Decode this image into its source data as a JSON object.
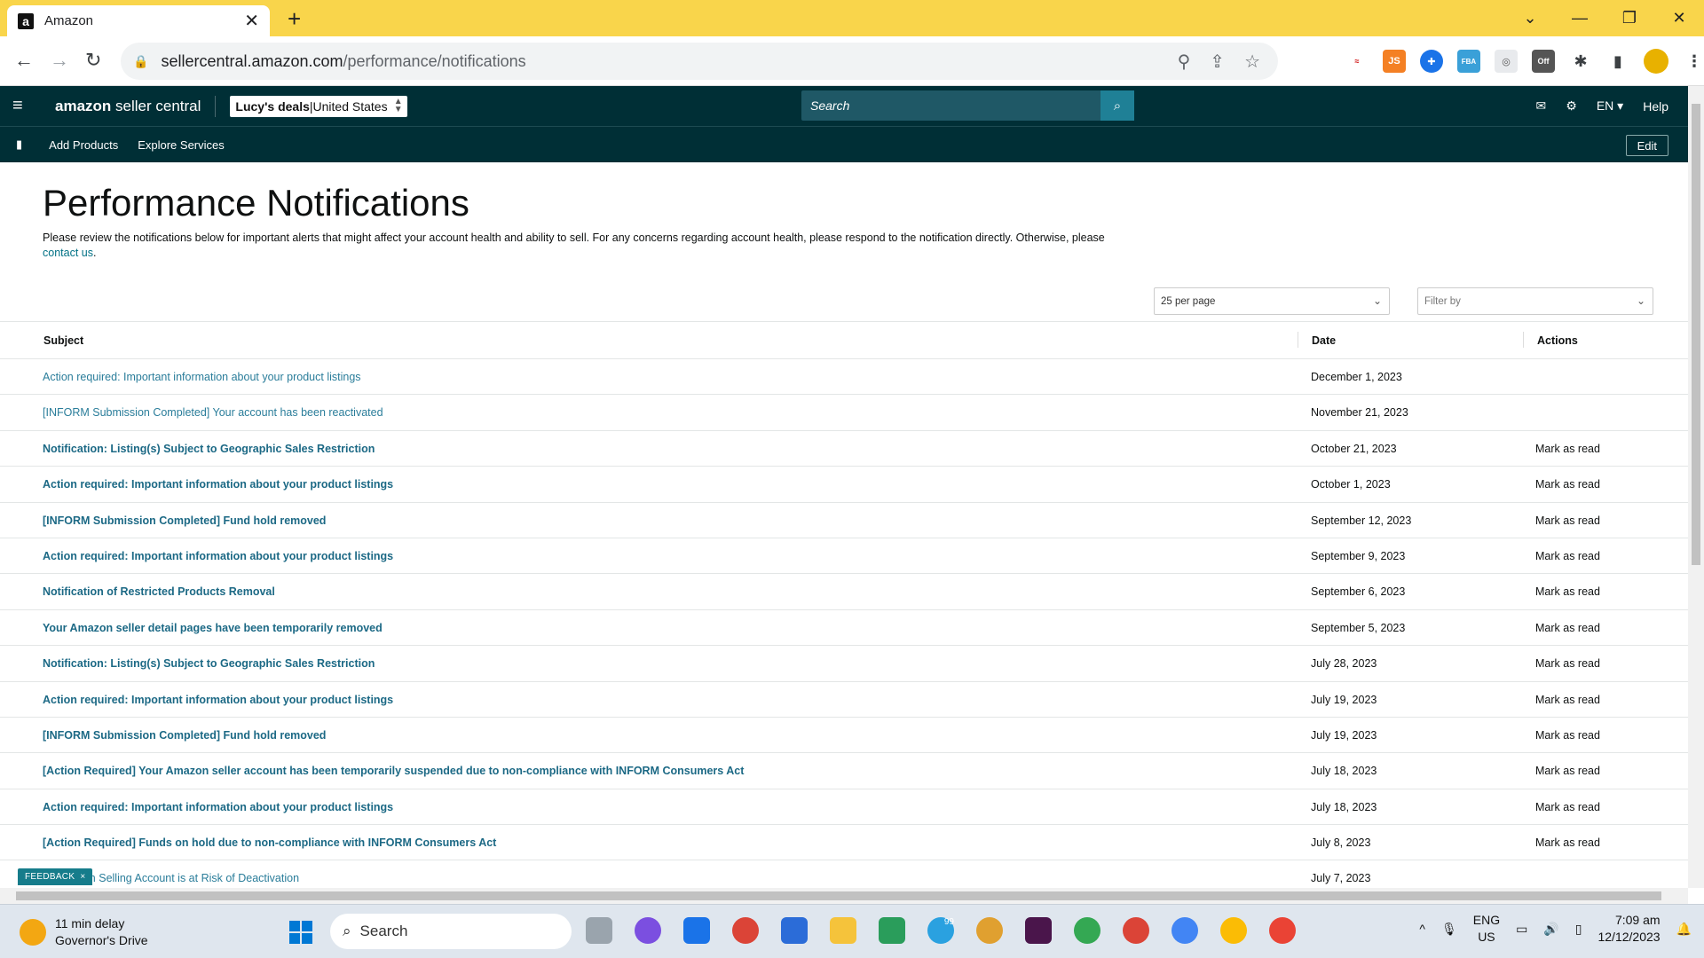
{
  "browser": {
    "tab_title": "Amazon",
    "tab_favicon": "a",
    "new_tab": "+",
    "url_host": "sellercentral.amazon.com",
    "url_path": "/performance/notifications"
  },
  "header": {
    "logo_bold": "amazon",
    "logo_rest": " seller central",
    "store_name": "Lucy's deals",
    "store_sep": " | ",
    "store_region": "United States",
    "search_placeholder": "Search",
    "lang": "EN",
    "help": "Help"
  },
  "subnav": {
    "links": [
      "Add Products",
      "Explore Services"
    ],
    "edit": "Edit"
  },
  "page": {
    "title": "Performance Notifications",
    "description": "Please review the notifications below for important alerts that might affect your account health and ability to sell. For any concerns regarding account health, please respond to the notification directly. Otherwise, please ",
    "contact_link": "contact us",
    "contact_end": ".",
    "per_page": "25 per page",
    "filter_placeholder": "Filter by"
  },
  "table": {
    "headers": {
      "subject": "Subject",
      "date": "Date",
      "actions": "Actions"
    },
    "rows": [
      {
        "subject": "Action required: Important information about your product listings",
        "date": "December 1, 2023",
        "action": "",
        "unread": false
      },
      {
        "subject": "[INFORM Submission Completed] Your account has been reactivated",
        "date": "November 21, 2023",
        "action": "",
        "unread": false
      },
      {
        "subject": "Notification: Listing(s) Subject to Geographic Sales Restriction",
        "date": "October 21, 2023",
        "action": "Mark as read",
        "unread": true
      },
      {
        "subject": "Action required: Important information about your product listings",
        "date": "October 1, 2023",
        "action": "Mark as read",
        "unread": true
      },
      {
        "subject": "[INFORM Submission Completed] Fund hold removed",
        "date": "September 12, 2023",
        "action": "Mark as read",
        "unread": true
      },
      {
        "subject": "Action required: Important information about your product listings",
        "date": "September 9, 2023",
        "action": "Mark as read",
        "unread": true
      },
      {
        "subject": "Notification of Restricted Products Removal",
        "date": "September 6, 2023",
        "action": "Mark as read",
        "unread": true
      },
      {
        "subject": "Your Amazon seller detail pages have been temporarily removed",
        "date": "September 5, 2023",
        "action": "Mark as read",
        "unread": true
      },
      {
        "subject": "Notification: Listing(s) Subject to Geographic Sales Restriction",
        "date": "July 28, 2023",
        "action": "Mark as read",
        "unread": true
      },
      {
        "subject": "Action required: Important information about your product listings",
        "date": "July 19, 2023",
        "action": "Mark as read",
        "unread": true
      },
      {
        "subject": "[INFORM Submission Completed] Fund hold removed",
        "date": "July 19, 2023",
        "action": "Mark as read",
        "unread": true
      },
      {
        "subject": "[Action Required] Your Amazon seller account has been temporarily suspended due to non-compliance with INFORM Consumers Act",
        "date": "July 18, 2023",
        "action": "Mark as read",
        "unread": true
      },
      {
        "subject": "Action required: Important information about your product listings",
        "date": "July 18, 2023",
        "action": "Mark as read",
        "unread": true
      },
      {
        "subject": "[Action Required] Funds on hold due to non-compliance with INFORM Consumers Act",
        "date": "July 8, 2023",
        "action": "Mark as read",
        "unread": true
      },
      {
        "subject": "ur Amazon Selling Account is at Risk of Deactivation",
        "date": "July 7, 2023",
        "action": "",
        "unread": false
      }
    ]
  },
  "feedback": {
    "label": "FEEDBACK",
    "close": "×"
  },
  "taskbar": {
    "weather_line1": "11 min delay",
    "weather_line2": "Governor's Drive",
    "search": "Search",
    "lang1": "ENG",
    "lang2": "US",
    "time": "7:09 am",
    "date": "12/12/2023",
    "telegram_badge": "99"
  },
  "colors": {
    "tab_strip": "#f9d54b",
    "header_bg": "#002f36",
    "link": "#1c6985",
    "search_btn": "#1f8096"
  }
}
